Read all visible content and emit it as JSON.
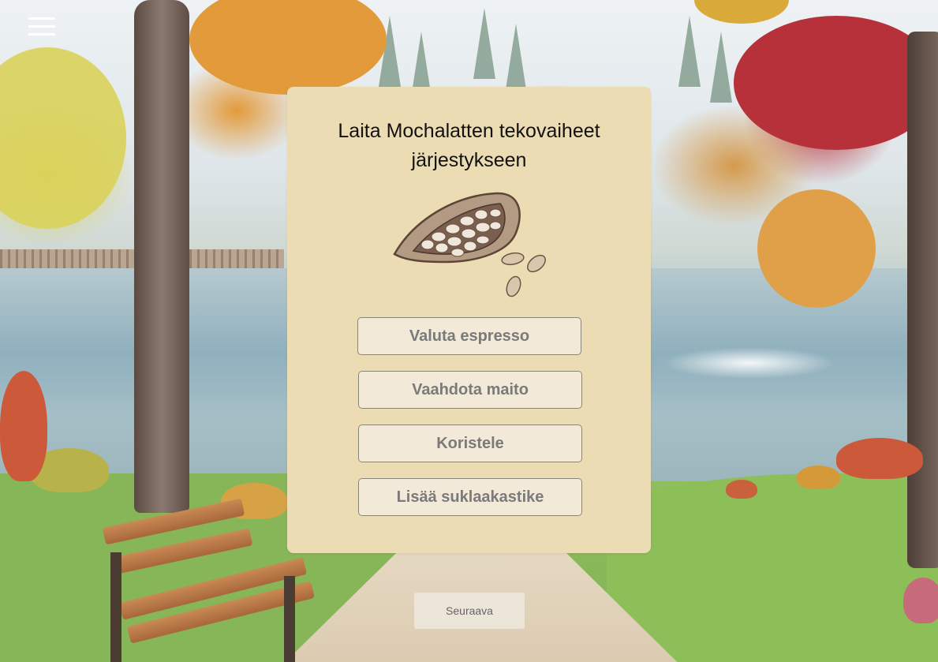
{
  "menu": {
    "icon": "hamburger-menu-icon"
  },
  "card": {
    "title": "Laita Mochalatten tekovaiheet järjestykseen",
    "illustration": "cocoa-pod-icon",
    "steps": [
      {
        "label": "Valuta espresso"
      },
      {
        "label": "Vaahdota maito"
      },
      {
        "label": "Koristele"
      },
      {
        "label": "Lisää suklaakastike"
      }
    ]
  },
  "footer": {
    "next_label": "Seuraava"
  },
  "colors": {
    "card_background": "#ecdcb4",
    "button_background": "#f2e9d8",
    "button_border": "#8b8579",
    "button_text": "#7a7a7a"
  }
}
